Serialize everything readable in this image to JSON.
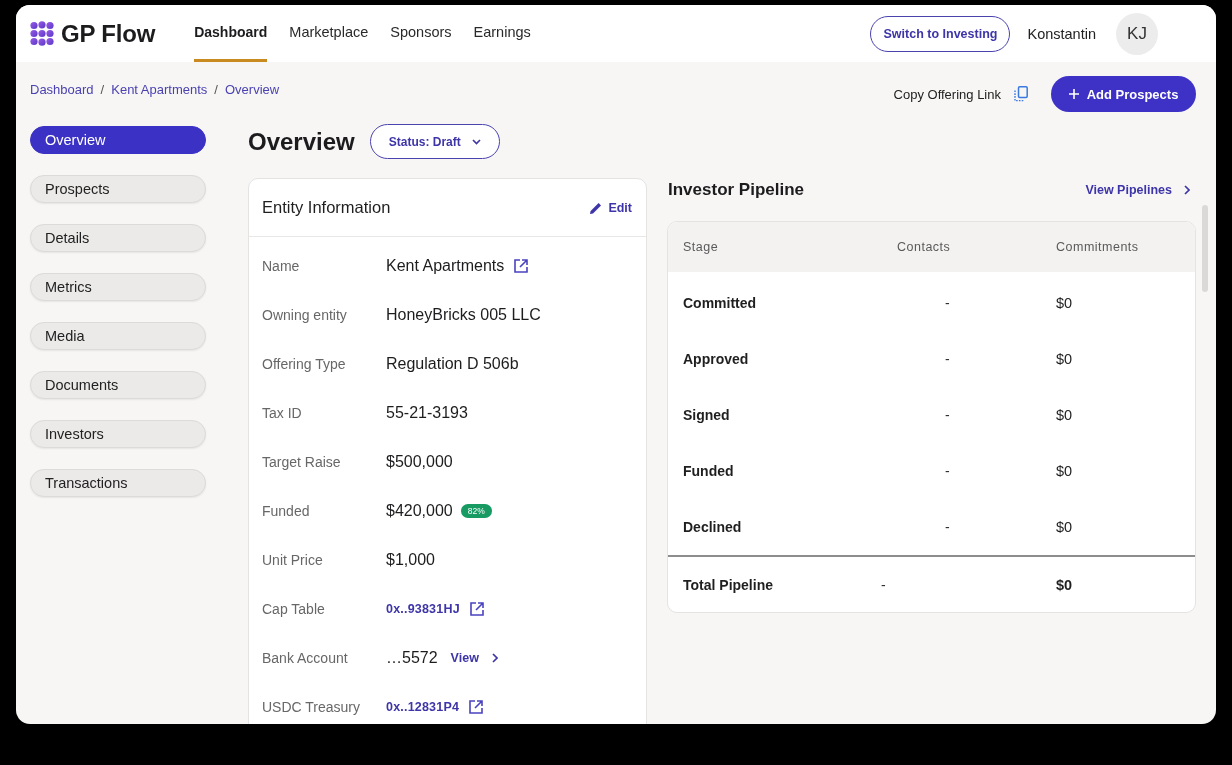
{
  "header": {
    "logo": "GP Flow",
    "nav": [
      {
        "label": "Dashboard",
        "selected": true
      },
      {
        "label": "Marketplace",
        "selected": false
      },
      {
        "label": "Sponsors",
        "selected": false
      },
      {
        "label": "Earnings",
        "selected": false
      }
    ],
    "switch_button": "Switch to Investing",
    "user_name": "Konstantin",
    "avatar_initials": "KJ"
  },
  "breadcrumb": [
    {
      "kind": "link",
      "text": "Dashboard"
    },
    {
      "kind": "separator",
      "text": "/"
    },
    {
      "kind": "link",
      "text": "Kent Apartments"
    },
    {
      "kind": "separator",
      "text": "/"
    },
    {
      "kind": "link",
      "text": "Overview"
    }
  ],
  "actions": {
    "copy_link": "Copy Offering Link",
    "add_button": "Add Prospects"
  },
  "sidebar": {
    "items": [
      {
        "label": "Overview",
        "selected": true
      },
      {
        "label": "Prospects",
        "selected": false
      },
      {
        "label": "Details",
        "selected": false
      },
      {
        "label": "Metrics",
        "selected": false
      },
      {
        "label": "Media",
        "selected": false
      },
      {
        "label": "Documents",
        "selected": false
      },
      {
        "label": "Investors",
        "selected": false
      },
      {
        "label": "Transactions",
        "selected": false
      }
    ]
  },
  "page": {
    "title": "Overview",
    "status": "Status: Draft"
  },
  "entity_info": {
    "title": "Entity Information",
    "edit": "Edit",
    "rows": [
      {
        "label": "Name",
        "value": "Kent Apartments",
        "kind": "plain",
        "external": true
      },
      {
        "label": "Owning entity",
        "value": "HoneyBricks 005 LLC",
        "kind": "plain"
      },
      {
        "label": "Offering Type",
        "value": "Regulation D 506b",
        "kind": "plain"
      },
      {
        "label": "Tax ID",
        "value": "55-21-3193",
        "kind": "plain"
      },
      {
        "label": "Target Raise",
        "value": "$500,000",
        "kind": "plain"
      },
      {
        "label": "Funded",
        "value": "$420,000",
        "kind": "plain",
        "badge": "82%"
      },
      {
        "label": "Unit Price",
        "value": "$1,000",
        "kind": "plain"
      },
      {
        "label": "Cap Table",
        "value": "0x..93831HJ",
        "kind": "address",
        "external": true
      },
      {
        "label": "Bank Account",
        "value": "…5572",
        "kind": "plain",
        "link": "View"
      },
      {
        "label": "USDC Treasury",
        "value": "0x..12831P4",
        "kind": "address",
        "external": true
      }
    ]
  },
  "pipeline": {
    "title": "Investor Pipeline",
    "link": "View Pipelines",
    "columns": [
      "Stage",
      "Contacts",
      "Commitments"
    ],
    "rows": [
      {
        "stage": "Committed",
        "contacts": "-",
        "commitments": "$0"
      },
      {
        "stage": "Approved",
        "contacts": "-",
        "commitments": "$0"
      },
      {
        "stage": "Signed",
        "contacts": "-",
        "commitments": "$0"
      },
      {
        "stage": "Funded",
        "contacts": "-",
        "commitments": "$0"
      },
      {
        "stage": "Declined",
        "contacts": "-",
        "commitments": "$0"
      }
    ],
    "total": {
      "stage": "Total Pipeline",
      "contacts": "-",
      "commitments": "$0"
    }
  }
}
